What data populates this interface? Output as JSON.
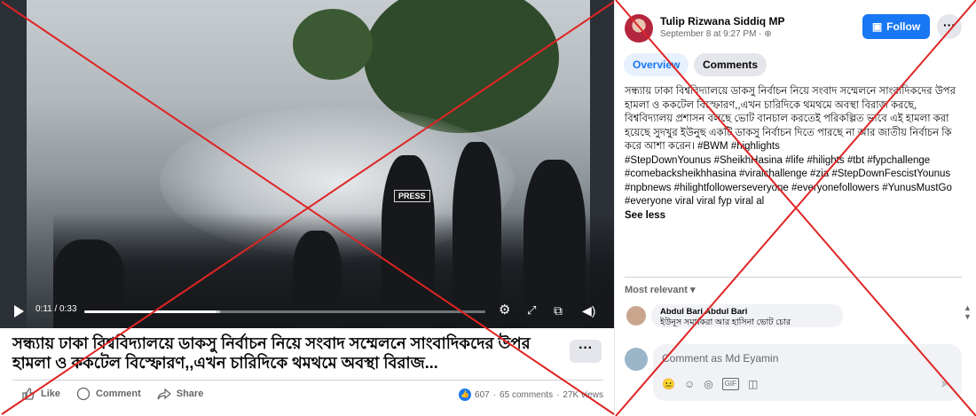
{
  "video": {
    "time": "0:11 / 0:33",
    "progress_fraction": 0.33,
    "press_label": "PRESS",
    "icons": [
      "play-icon",
      "settings-icon",
      "fullscreen-icon",
      "pip-icon",
      "volume-icon"
    ]
  },
  "post": {
    "title": "সন্ধ্যায় ঢাকা বিশ্ববিদ্যালয়ে ডাকসু নির্বাচন নিয়ে সংবাদ সম্মেলনে সাংবাদিকদের উপর হামলা ও ককটেল বিস্ফোরণ,,এখন চারিদিকে থমথমে অবস্থা বিরাজ...",
    "more_label": "···",
    "actions": {
      "like": "Like",
      "comment": "Comment",
      "share": "Share"
    },
    "stats": {
      "reactions": "607",
      "comments": "65 comments",
      "views": "27K views",
      "separator": "·"
    }
  },
  "sidebar": {
    "author": "Tulip Rizwana Siddiq MP",
    "date": "September 8 at 9:27 PM · ",
    "follow_label": "Follow",
    "dots_label": "···",
    "tabs": {
      "overview": "Overview",
      "comments": "Comments"
    },
    "caption": [
      "সন্ধ্যায় ঢাকা বিশ্ববিদ্যালয়ে ডাকসু নির্বাচন নিয়ে সংবাদ সম্মেলনে সাংবাদিকদের উপর হামলা ও ককটেল বিস্ফোরণ,,এখন চারিদিকে থমথমে অবস্থা বিরাজ করছে,",
      "বিশ্ববিদ্যালয় প্রশাসন বলছে ভোট বানচাল করতেই পরিকল্পিত ভাবে এই হামলা করা হয়েছে সুদখুর ইউনুছ একটি ডাকসু নির্বাচন দিতে পারছে না আর জাতীয় নির্বাচন কি করে আশা করেন। #BWM #highlights",
      "#StepDownYounus #SheikhHasina #life #hilights #tbt #fypchallenge #comebacksheikhhasina #viralchallenge #zia #StepDownFescistYounus #npbnews #hilightfollowerseveryone #everyonefollowers #YunusMustGo #everyone viral viral fyp viral al"
    ],
    "see_less": "See less",
    "most_relevant": "Most relevant ▾",
    "comment": {
      "name": "Abdul Bari Abdul Bari",
      "text": "ইউনূস সমর্থকরা আর হাসিনা ভোট চোর"
    },
    "composer": {
      "placeholder": "Comment as Md Eyamin",
      "icons": [
        "😐",
        "☺",
        "◎",
        "GIF",
        "◫"
      ],
      "send": "➤"
    }
  },
  "colors": {
    "accent": "#1877f2",
    "overlay_x": "#e02424"
  }
}
